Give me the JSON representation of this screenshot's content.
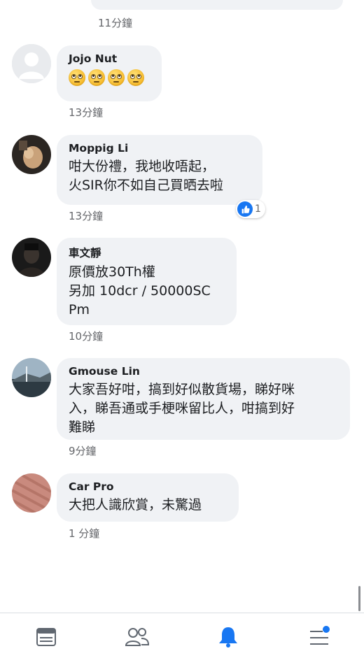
{
  "top": {
    "timestamp": "11分鐘"
  },
  "comments": [
    {
      "author": "Jojo Nut",
      "text": "",
      "timestamp": "13分鐘",
      "emoji_icon": "face-with-rolling-eyes-icon"
    },
    {
      "author": "Moppig Li",
      "text": "咁大份禮，我地收唔起，\n火SIR你不如自己買晒去啦",
      "timestamp": "13分鐘",
      "reaction": {
        "icon": "like-icon",
        "count": "1"
      }
    },
    {
      "author": "車文靜",
      "text": "原價放30Th權\n另加 10dcr / 50000SC\nPm",
      "timestamp": "10分鐘"
    },
    {
      "author": "Gmouse Lin",
      "text": "大家吾好咁，搞到好似散貨場，睇好咪\n入，睇吾通或手梗咪留比人，咁搞到好\n難睇",
      "timestamp": "9分鐘"
    },
    {
      "author": "Car Pro",
      "text": "大把人識欣賞，未驚過",
      "timestamp": "1 分鐘"
    }
  ],
  "nav": {
    "items": [
      {
        "icon": "news-feed-icon"
      },
      {
        "icon": "friends-icon"
      },
      {
        "icon": "notifications-bell-icon",
        "active": true
      },
      {
        "icon": "menu-icon",
        "badge": true
      }
    ]
  },
  "colors": {
    "accent": "#1877f2",
    "bubble": "#f0f2f5",
    "muted": "#65676b"
  }
}
